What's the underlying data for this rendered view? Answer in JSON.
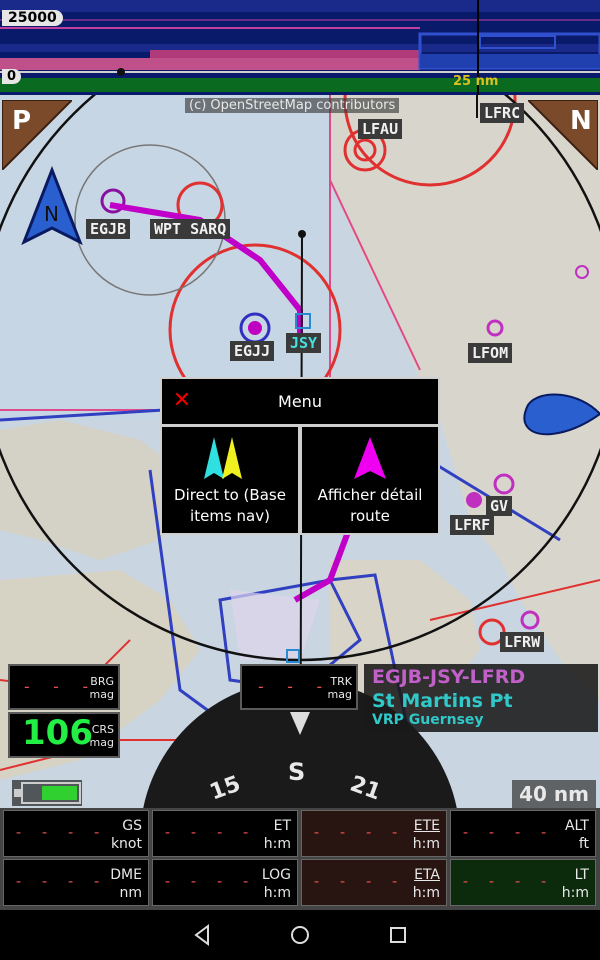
{
  "profile": {
    "altitude_top": "25000",
    "altitude_bottom": "0",
    "distance": "25 nm"
  },
  "map": {
    "attribution": "(c) OpenStreetMap contributors",
    "labels": {
      "lfau": "LFAU",
      "lfrc": "LFRC",
      "egjb": "EGJB",
      "wpt": "WPT SARQ",
      "egjj": "EGJJ",
      "jsy": "JSY",
      "lfom": "LFOM",
      "gv": "GV",
      "lfrf": "LFRF",
      "lfrw": "LFRW",
      "st": "St"
    },
    "corner_left": "P",
    "corner_right": "N",
    "north": "N",
    "scale": "40 nm"
  },
  "menu": {
    "title": "Menu",
    "items": [
      {
        "label_line1": "Direct to (Base",
        "label_line2": "items nav)"
      },
      {
        "label_line1": "Afficher détail",
        "label_line2": "route"
      }
    ]
  },
  "instruments": {
    "brg": {
      "value": "- - -",
      "unit1": "BRG",
      "unit2": "mag"
    },
    "crs": {
      "value": "106",
      "unit1": "CRS",
      "unit2": "mag"
    },
    "trk": {
      "value": "- - -",
      "unit1": "TRK",
      "unit2": "mag"
    }
  },
  "route": {
    "title": "EGJB-JSY-LFRD",
    "waypoint": "St Martins Pt",
    "subtitle": "VRP Guernsey"
  },
  "compass": {
    "s": "S",
    "left": "15",
    "right": "21"
  },
  "data_grid": [
    {
      "label": "GS",
      "unit": "knot",
      "value": "- - - -"
    },
    {
      "label": "ET",
      "unit": "h:m",
      "value": "- - - -"
    },
    {
      "label": "ETE",
      "unit": "h:m",
      "value": "- - - -"
    },
    {
      "label": "ALT",
      "unit": "ft",
      "value": "- - - -"
    },
    {
      "label": "DME",
      "unit": "nm",
      "value": "- - - -"
    },
    {
      "label": "LOG",
      "unit": "h:m",
      "value": "- - - -"
    },
    {
      "label": "ETA",
      "unit": "h:m",
      "value": "- - - -"
    },
    {
      "label": "LT",
      "unit": "h:m",
      "value": "- - - -"
    }
  ],
  "colors": {
    "route": "#cc00cc",
    "crs_value": "#22ee44",
    "dashes": "#e85050",
    "route_title": "#c060c8",
    "route_waypoint": "#30c8c8"
  }
}
